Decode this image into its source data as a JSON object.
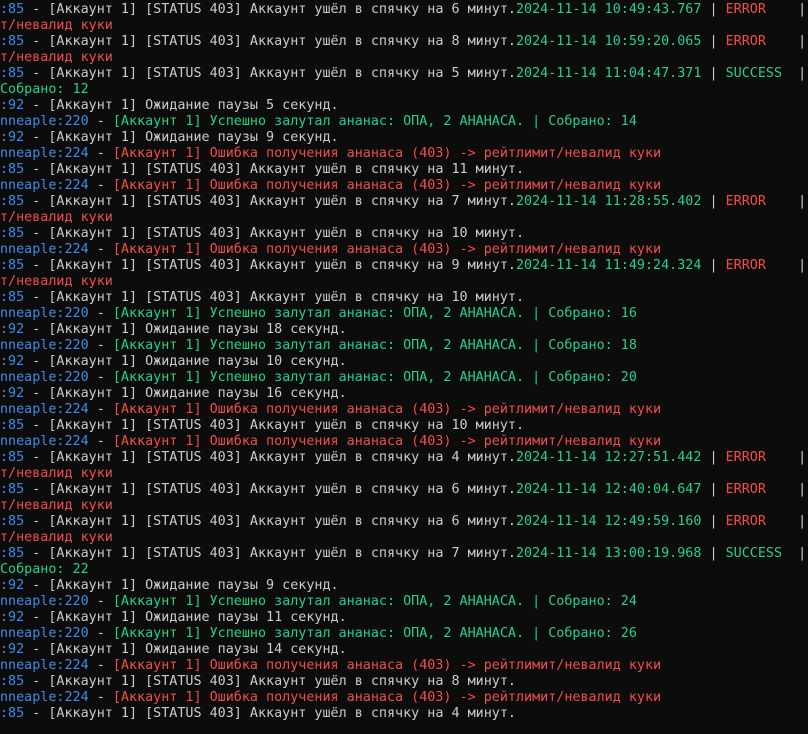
{
  "colors": {
    "background": "#0c0c0c",
    "text": "#cccccc",
    "module": "#3b8eea",
    "success": "#23d18b",
    "error": "#f14c4c",
    "timestamp": "#23d18b",
    "trailing": "#e5e510"
  },
  "lines": [
    [
      {
        "t": ":85",
        "c": "blue"
      },
      {
        "t": " - [Аккаунт 1] [STATUS 403] Аккаунт ушёл в спячку на 6 минут.",
        "c": "white"
      },
      {
        "t": "2024-11-14 10:49:43.767",
        "c": "ts"
      },
      {
        "t": " | ",
        "c": "sep"
      },
      {
        "t": "ERROR",
        "c": "red"
      },
      {
        "t": "    | ",
        "c": "sep"
      },
      {
        "t": "_",
        "c": "yellow"
      }
    ],
    [
      {
        "t": "т/невалид куки",
        "c": "red"
      }
    ],
    [
      {
        "t": ":85",
        "c": "blue"
      },
      {
        "t": " - [Аккаунт 1] [STATUS 403] Аккаунт ушёл в спячку на 8 минут.",
        "c": "white"
      },
      {
        "t": "2024-11-14 10:59:20.065",
        "c": "ts"
      },
      {
        "t": " | ",
        "c": "sep"
      },
      {
        "t": "ERROR",
        "c": "red"
      },
      {
        "t": "    | ",
        "c": "sep"
      },
      {
        "t": "_",
        "c": "yellow"
      }
    ],
    [
      {
        "t": "т/невалид куки",
        "c": "red"
      }
    ],
    [
      {
        "t": ":85",
        "c": "blue"
      },
      {
        "t": " - [Аккаунт 1] [STATUS 403] Аккаунт ушёл в спячку на 5 минут.",
        "c": "white"
      },
      {
        "t": "2024-11-14 11:04:47.371",
        "c": "ts"
      },
      {
        "t": " | ",
        "c": "sep"
      },
      {
        "t": "SUCCESS",
        "c": "green"
      },
      {
        "t": "  | ",
        "c": "sep"
      },
      {
        "t": "_",
        "c": "yellow"
      }
    ],
    [
      {
        "t": "Собрано: 12",
        "c": "green"
      }
    ],
    [
      {
        "t": ":92",
        "c": "blue"
      },
      {
        "t": " - [Аккаунт 1] Ожидание паузы 5 секунд.",
        "c": "white"
      }
    ],
    [
      {
        "t": "nneaple:220",
        "c": "blue"
      },
      {
        "t": " - ",
        "c": "white"
      },
      {
        "t": "[Аккаунт 1] Успешно залутал ананас: ОПА, 2 АНАНАСА. | Собрано: 14",
        "c": "green"
      }
    ],
    [
      {
        "t": ":92",
        "c": "blue"
      },
      {
        "t": " - [Аккаунт 1] Ожидание паузы 9 секунд.",
        "c": "white"
      }
    ],
    [
      {
        "t": "nneaple:224",
        "c": "blue"
      },
      {
        "t": " - ",
        "c": "white"
      },
      {
        "t": "[Аккаунт 1] Ошибка получения ананаса (403) -> рейтлимит/невалид куки",
        "c": "red"
      }
    ],
    [
      {
        "t": ":85",
        "c": "blue"
      },
      {
        "t": " - [Аккаунт 1] [STATUS 403] Аккаунт ушёл в спячку на 11 минут.",
        "c": "white"
      }
    ],
    [
      {
        "t": "nneaple:224",
        "c": "blue"
      },
      {
        "t": " - ",
        "c": "white"
      },
      {
        "t": "[Аккаунт 1] Ошибка получения ананаса (403) -> рейтлимит/невалид куки",
        "c": "red"
      }
    ],
    [
      {
        "t": ":85",
        "c": "blue"
      },
      {
        "t": " - [Аккаунт 1] [STATUS 403] Аккаунт ушёл в спячку на 7 минут.",
        "c": "white"
      },
      {
        "t": "2024-11-14 11:28:55.402",
        "c": "ts"
      },
      {
        "t": " | ",
        "c": "sep"
      },
      {
        "t": "ERROR",
        "c": "red"
      },
      {
        "t": "    | ",
        "c": "sep"
      },
      {
        "t": "_",
        "c": "yellow"
      }
    ],
    [
      {
        "t": "т/невалид куки",
        "c": "red"
      }
    ],
    [
      {
        "t": ":85",
        "c": "blue"
      },
      {
        "t": " - [Аккаунт 1] [STATUS 403] Аккаунт ушёл в спячку на 10 минут.",
        "c": "white"
      }
    ],
    [
      {
        "t": "nneaple:224",
        "c": "blue"
      },
      {
        "t": " - ",
        "c": "white"
      },
      {
        "t": "[Аккаунт 1] Ошибка получения ананаса (403) -> рейтлимит/невалид куки",
        "c": "red"
      }
    ],
    [
      {
        "t": ":85",
        "c": "blue"
      },
      {
        "t": " - [Аккаунт 1] [STATUS 403] Аккаунт ушёл в спячку на 9 минут.",
        "c": "white"
      },
      {
        "t": "2024-11-14 11:49:24.324",
        "c": "ts"
      },
      {
        "t": " | ",
        "c": "sep"
      },
      {
        "t": "ERROR",
        "c": "red"
      },
      {
        "t": "    | ",
        "c": "sep"
      },
      {
        "t": "_",
        "c": "yellow"
      }
    ],
    [
      {
        "t": "т/невалид куки",
        "c": "red"
      }
    ],
    [
      {
        "t": ":85",
        "c": "blue"
      },
      {
        "t": " - [Аккаунт 1] [STATUS 403] Аккаунт ушёл в спячку на 10 минут.",
        "c": "white"
      }
    ],
    [
      {
        "t": "nneaple:220",
        "c": "blue"
      },
      {
        "t": " - ",
        "c": "white"
      },
      {
        "t": "[Аккаунт 1] Успешно залутал ананас: ОПА, 2 АНАНАСА. | Собрано: 16",
        "c": "green"
      }
    ],
    [
      {
        "t": ":92",
        "c": "blue"
      },
      {
        "t": " - [Аккаунт 1] Ожидание паузы 18 секунд.",
        "c": "white"
      }
    ],
    [
      {
        "t": "nneaple:220",
        "c": "blue"
      },
      {
        "t": " - ",
        "c": "white"
      },
      {
        "t": "[Аккаунт 1] Успешно залутал ананас: ОПА, 2 АНАНАСА. | Собрано: 18",
        "c": "green"
      }
    ],
    [
      {
        "t": ":92",
        "c": "blue"
      },
      {
        "t": " - [Аккаунт 1] Ожидание паузы 10 секунд.",
        "c": "white"
      }
    ],
    [
      {
        "t": "nneaple:220",
        "c": "blue"
      },
      {
        "t": " - ",
        "c": "white"
      },
      {
        "t": "[Аккаунт 1] Успешно залутал ананас: ОПА, 2 АНАНАСА. | Собрано: 20",
        "c": "green"
      }
    ],
    [
      {
        "t": ":92",
        "c": "blue"
      },
      {
        "t": " - [Аккаунт 1] Ожидание паузы 16 секунд.",
        "c": "white"
      }
    ],
    [
      {
        "t": "nneaple:224",
        "c": "blue"
      },
      {
        "t": " - ",
        "c": "white"
      },
      {
        "t": "[Аккаунт 1] Ошибка получения ананаса (403) -> рейтлимит/невалид куки",
        "c": "red"
      }
    ],
    [
      {
        "t": ":85",
        "c": "blue"
      },
      {
        "t": " - [Аккаунт 1] [STATUS 403] Аккаунт ушёл в спячку на 10 минут.",
        "c": "white"
      }
    ],
    [
      {
        "t": "nneaple:224",
        "c": "blue"
      },
      {
        "t": " - ",
        "c": "white"
      },
      {
        "t": "[Аккаунт 1] Ошибка получения ананаса (403) -> рейтлимит/невалид куки",
        "c": "red"
      }
    ],
    [
      {
        "t": ":85",
        "c": "blue"
      },
      {
        "t": " - [Аккаунт 1] [STATUS 403] Аккаунт ушёл в спячку на 4 минут.",
        "c": "white"
      },
      {
        "t": "2024-11-14 12:27:51.442",
        "c": "ts"
      },
      {
        "t": " | ",
        "c": "sep"
      },
      {
        "t": "ERROR",
        "c": "red"
      },
      {
        "t": "    | ",
        "c": "sep"
      },
      {
        "t": "_",
        "c": "yellow"
      }
    ],
    [
      {
        "t": "т/невалид куки",
        "c": "red"
      }
    ],
    [
      {
        "t": ":85",
        "c": "blue"
      },
      {
        "t": " - [Аккаунт 1] [STATUS 403] Аккаунт ушёл в спячку на 6 минут.",
        "c": "white"
      },
      {
        "t": "2024-11-14 12:40:04.647",
        "c": "ts"
      },
      {
        "t": " | ",
        "c": "sep"
      },
      {
        "t": "ERROR",
        "c": "red"
      },
      {
        "t": "    | ",
        "c": "sep"
      },
      {
        "t": "_",
        "c": "yellow"
      }
    ],
    [
      {
        "t": "т/невалид куки",
        "c": "red"
      }
    ],
    [
      {
        "t": ":85",
        "c": "blue"
      },
      {
        "t": " - [Аккаунт 1] [STATUS 403] Аккаунт ушёл в спячку на 6 минут.",
        "c": "white"
      },
      {
        "t": "2024-11-14 12:49:59.160",
        "c": "ts"
      },
      {
        "t": " | ",
        "c": "sep"
      },
      {
        "t": "ERROR",
        "c": "red"
      },
      {
        "t": "    | ",
        "c": "sep"
      },
      {
        "t": "_",
        "c": "yellow"
      }
    ],
    [
      {
        "t": "т/невалид куки",
        "c": "red"
      }
    ],
    [
      {
        "t": ":85",
        "c": "blue"
      },
      {
        "t": " - [Аккаунт 1] [STATUS 403] Аккаунт ушёл в спячку на 7 минут.",
        "c": "white"
      },
      {
        "t": "2024-11-14 13:00:19.968",
        "c": "ts"
      },
      {
        "t": " | ",
        "c": "sep"
      },
      {
        "t": "SUCCESS",
        "c": "green"
      },
      {
        "t": "  | ",
        "c": "sep"
      },
      {
        "t": "_",
        "c": "yellow"
      }
    ],
    [
      {
        "t": "Собрано: 22",
        "c": "green"
      }
    ],
    [
      {
        "t": ":92",
        "c": "blue"
      },
      {
        "t": " - [Аккаунт 1] Ожидание паузы 9 секунд.",
        "c": "white"
      }
    ],
    [
      {
        "t": "nneaple:220",
        "c": "blue"
      },
      {
        "t": " - ",
        "c": "white"
      },
      {
        "t": "[Аккаунт 1] Успешно залутал ананас: ОПА, 2 АНАНАСА. | Собрано: 24",
        "c": "green"
      }
    ],
    [
      {
        "t": ":92",
        "c": "blue"
      },
      {
        "t": " - [Аккаунт 1] Ожидание паузы 11 секунд.",
        "c": "white"
      }
    ],
    [
      {
        "t": "nneaple:220",
        "c": "blue"
      },
      {
        "t": " - ",
        "c": "white"
      },
      {
        "t": "[Аккаунт 1] Успешно залутал ананас: ОПА, 2 АНАНАСА. | Собрано: 26",
        "c": "green"
      }
    ],
    [
      {
        "t": ":92",
        "c": "blue"
      },
      {
        "t": " - [Аккаунт 1] Ожидание паузы 14 секунд.",
        "c": "white"
      }
    ],
    [
      {
        "t": "nneaple:224",
        "c": "blue"
      },
      {
        "t": " - ",
        "c": "white"
      },
      {
        "t": "[Аккаунт 1] Ошибка получения ананаса (403) -> рейтлимит/невалид куки",
        "c": "red"
      }
    ],
    [
      {
        "t": ":85",
        "c": "blue"
      },
      {
        "t": " - [Аккаунт 1] [STATUS 403] Аккаунт ушёл в спячку на 8 минут.",
        "c": "white"
      }
    ],
    [
      {
        "t": "nneaple:224",
        "c": "blue"
      },
      {
        "t": " - ",
        "c": "white"
      },
      {
        "t": "[Аккаунт 1] Ошибка получения ананаса (403) -> рейтлимит/невалид куки",
        "c": "red"
      }
    ],
    [
      {
        "t": ":85",
        "c": "blue"
      },
      {
        "t": " - [Аккаунт 1] [STATUS 403] Аккаунт ушёл в спячку на 4 минут.",
        "c": "white"
      }
    ]
  ]
}
